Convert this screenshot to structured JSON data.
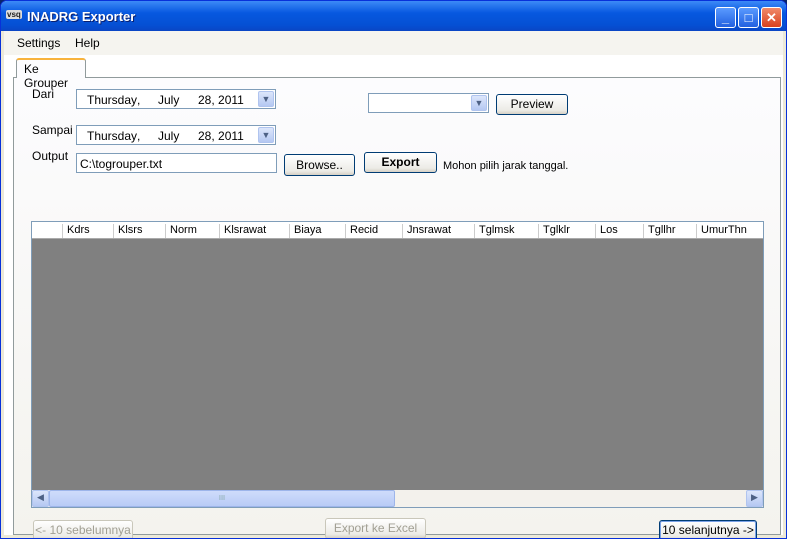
{
  "window": {
    "title": "INADRG Exporter",
    "logo": "vsq",
    "minimize": "_",
    "maximize": "□",
    "close": "✕"
  },
  "menu": [
    "Settings",
    "Help"
  ],
  "tab": "Ke Grouper",
  "form": {
    "dari_label": "Dari",
    "dari": {
      "weekday": "Thursday",
      "sep": ",",
      "month": "July",
      "day_year": "28, 2011"
    },
    "sampai_label": "Sampai",
    "sampai": {
      "weekday": "Thursday",
      "sep": ",",
      "month": "July",
      "day_year": "28, 2011"
    },
    "output_label": "Output",
    "output_value": "C:\\togrouper.txt",
    "browse": "Browse..",
    "export": "Export",
    "status": "Mohon pilih jarak tanggal.",
    "combo_value": "",
    "preview": "Preview"
  },
  "grid": {
    "columns": [
      "Kdrs",
      "Klsrs",
      "Norm",
      "Klsrawat",
      "Biaya",
      "Recid",
      "Jnsrawat",
      "Tglmsk",
      "Tglklr",
      "Los",
      "Tgllhr",
      "UmurThn"
    ],
    "scroll_grip": "III"
  },
  "footer": {
    "prev": "<- 10 sebelumnya",
    "excel": "Export ke Excel",
    "next": "10 selanjutnya ->"
  }
}
